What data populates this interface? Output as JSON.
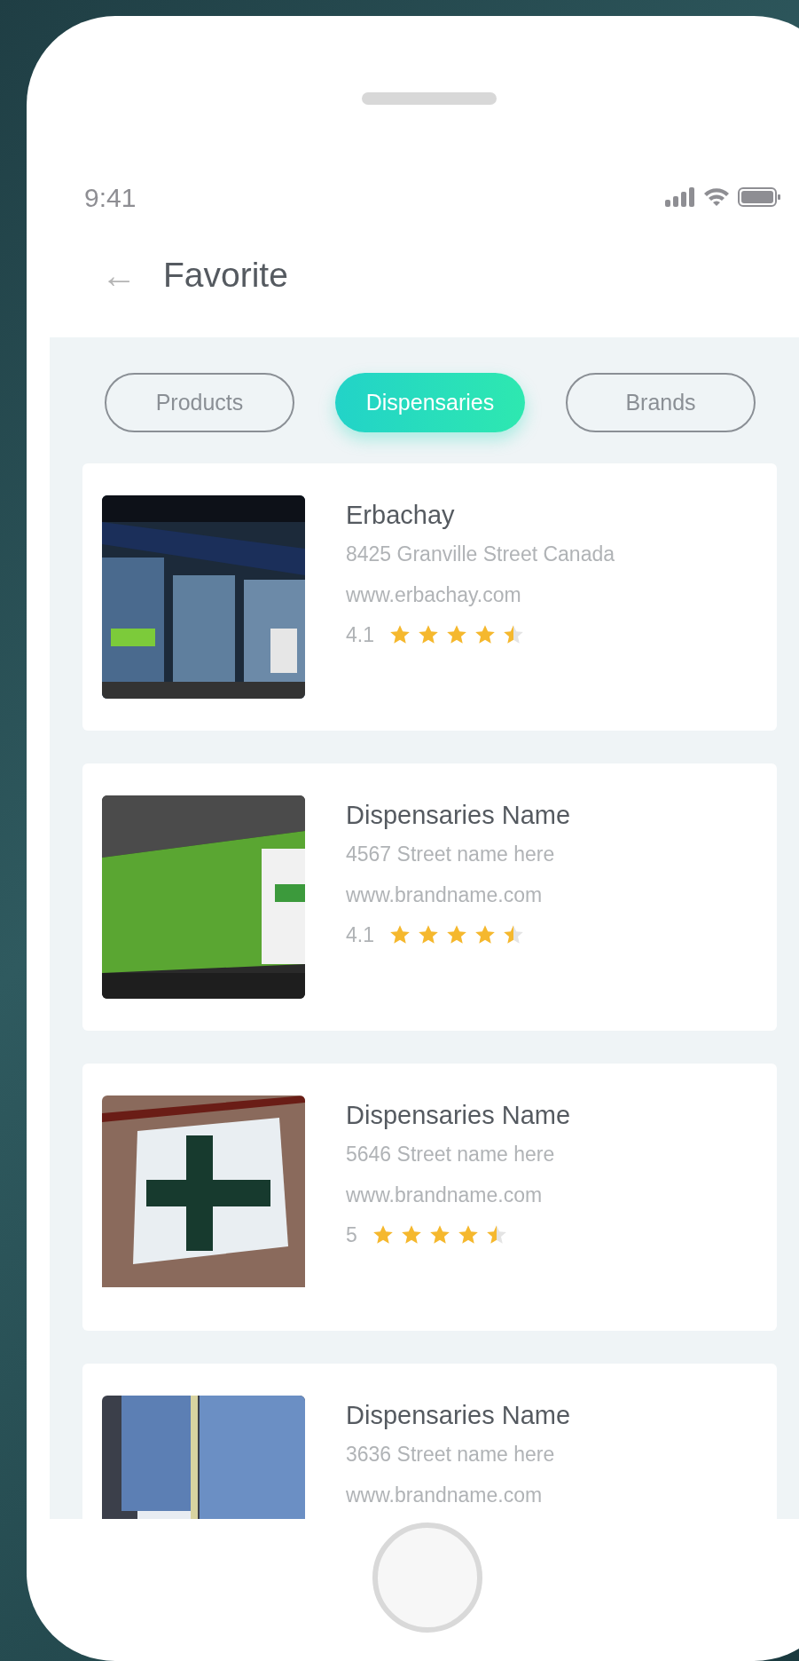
{
  "status_bar": {
    "time": "9:41"
  },
  "header": {
    "back": "←",
    "title": "Favorite"
  },
  "tabs": [
    {
      "label": "Products",
      "selected": false
    },
    {
      "label": "Dispensaries",
      "selected": true
    },
    {
      "label": "Brands",
      "selected": false
    }
  ],
  "cards": [
    {
      "name": "Erbachay",
      "address": "8425 Granville Street Canada",
      "url": "www.erbachay.com",
      "rating": "4.1",
      "stars": 4.5
    },
    {
      "name": "Dispensaries Name",
      "address": "4567 Street name here",
      "url": "www.brandname.com",
      "rating": "4.1",
      "stars": 4.5
    },
    {
      "name": "Dispensaries Name",
      "address": "5646 Street name here",
      "url": "www.brandname.com",
      "rating": "5",
      "stars": 4.5
    },
    {
      "name": "Dispensaries Name",
      "address": "3636 Street name here",
      "url": "www.brandname.com"
    }
  ]
}
